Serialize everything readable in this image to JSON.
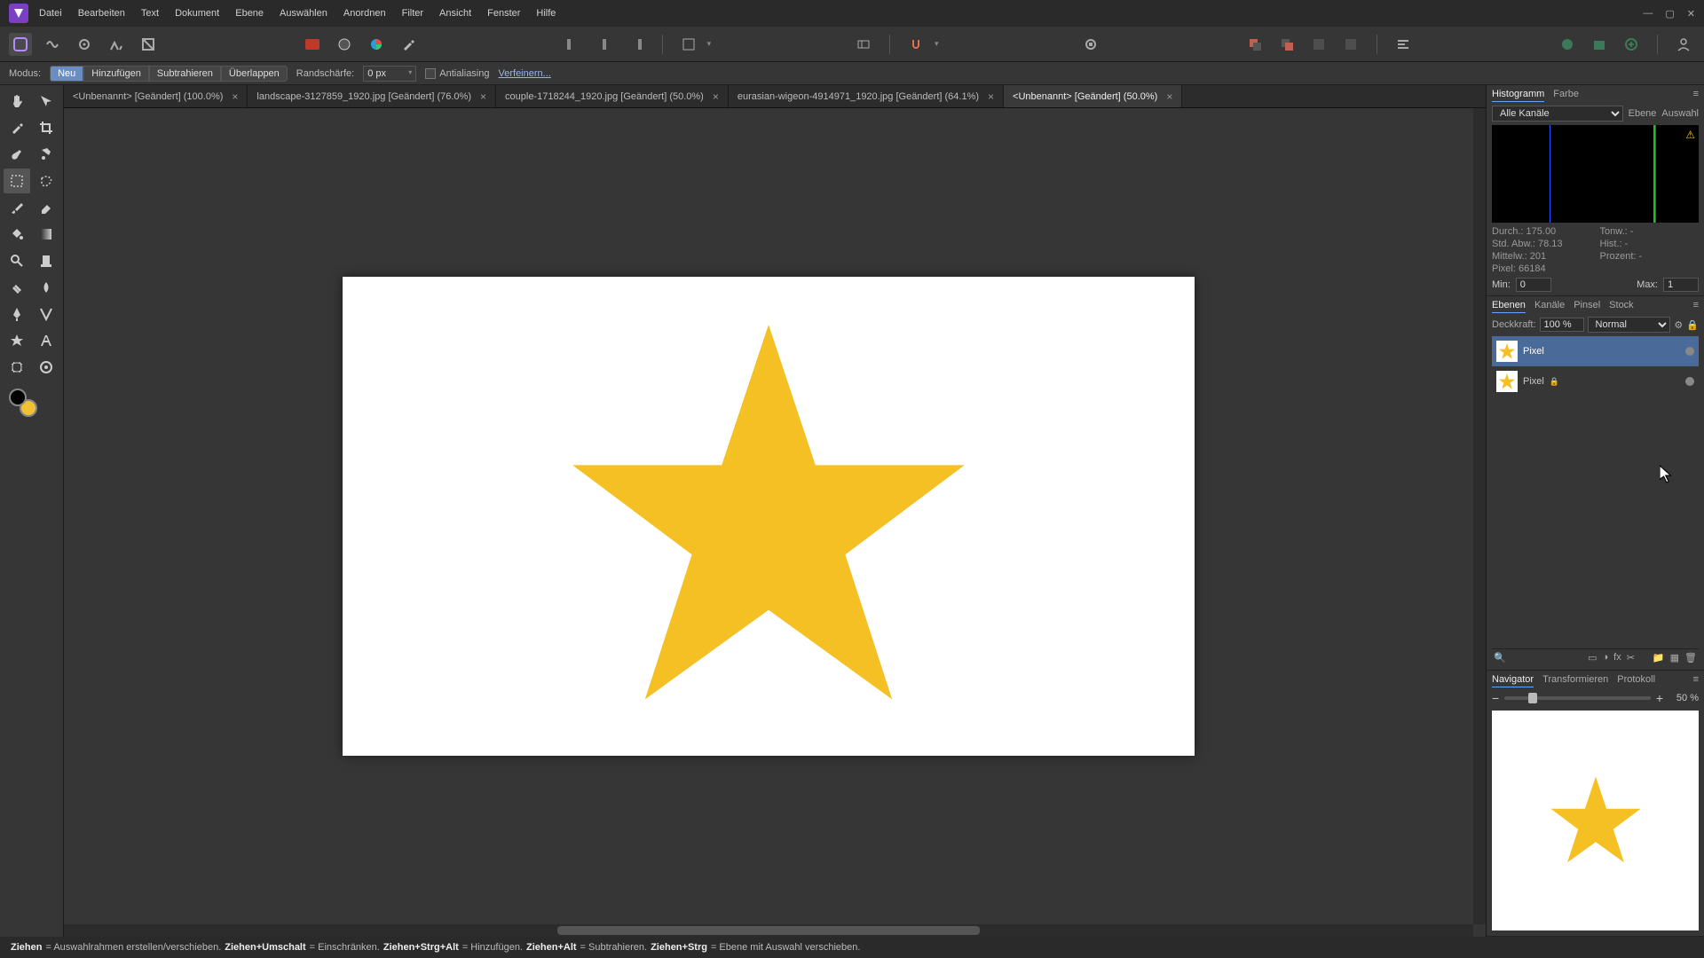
{
  "menu": {
    "items": [
      "Datei",
      "Bearbeiten",
      "Text",
      "Dokument",
      "Ebene",
      "Auswählen",
      "Anordnen",
      "Filter",
      "Ansicht",
      "Fenster",
      "Hilfe"
    ]
  },
  "context": {
    "mode_label": "Modus:",
    "mode_new": "Neu",
    "mode_add": "Hinzufügen",
    "mode_sub": "Subtrahieren",
    "mode_inter": "Überlappen",
    "feather_label": "Randschärfe:",
    "feather_value": "0 px",
    "antialias": "Antialiasing",
    "refine": "Verfeinern..."
  },
  "tabs": [
    {
      "label": "<Unbenannt> [Geändert] (100.0%)"
    },
    {
      "label": "landscape-3127859_1920.jpg [Geändert] (76.0%)"
    },
    {
      "label": "couple-1718244_1920.jpg [Geändert] (50.0%)"
    },
    {
      "label": "eurasian-wigeon-4914971_1920.jpg [Geändert] (64.1%)"
    },
    {
      "label": "<Unbenannt> [Geändert] (50.0%)"
    }
  ],
  "histogram": {
    "tab1": "Histogramm",
    "tab2": "Farbe",
    "channel": "Alle Kanäle",
    "src_layer": "Ebene",
    "src_sel": "Auswahl",
    "stats": {
      "durch_label": "Durch.:",
      "durch": "175.00",
      "std_label": "Std. Abw.:",
      "std": "78.13",
      "median_label": "Mittelw.:",
      "median": "201",
      "pixel_label": "Pixel:",
      "pixel": "66184",
      "ton_label": "Tonw.:",
      "ton": "-",
      "hist_label": "Hist.:",
      "hist": "-",
      "perc_label": "Prozent:",
      "perc": "-"
    },
    "min_label": "Min:",
    "min": "0",
    "max_label": "Max:",
    "max": "1"
  },
  "layers": {
    "tab1": "Ebenen",
    "tab2": "Kanäle",
    "tab3": "Pinsel",
    "tab4": "Stock",
    "opacity_label": "Deckkraft:",
    "opacity": "100 %",
    "blend": "Normal",
    "items": [
      {
        "name": "Pixel"
      },
      {
        "name": "Pixel"
      }
    ]
  },
  "navigator": {
    "tab1": "Navigator",
    "tab2": "Transformieren",
    "tab3": "Protokoll",
    "zoom": "50 %"
  },
  "status": {
    "s1b": "Ziehen",
    "s1": " = Auswahlrahmen erstellen/verschieben. ",
    "s2b": "Ziehen+Umschalt",
    "s2": " = Einschränken. ",
    "s3b": "Ziehen+Strg+Alt",
    "s3": " = Hinzufügen. ",
    "s4b": "Ziehen+Alt",
    "s4": " = Subtrahieren. ",
    "s5b": "Ziehen+Strg",
    "s5": " = Ebene mit Auswahl verschieben."
  },
  "canvas": {
    "artboard_w": 960,
    "artboard_h": 540,
    "star_color": "#f4c024"
  }
}
